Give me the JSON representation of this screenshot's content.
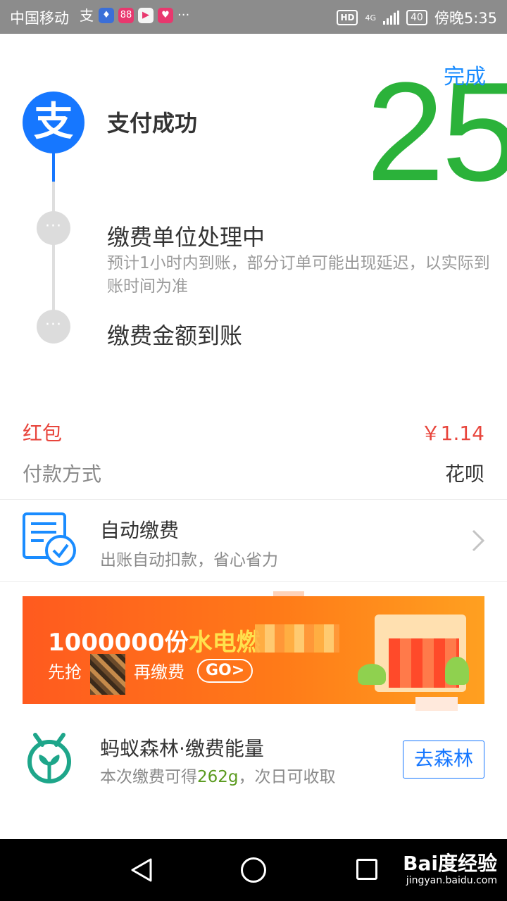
{
  "status_bar": {
    "carrier": "中国移动",
    "notif_1": "支",
    "notif_2": "♦",
    "notif_3": "88",
    "notif_4": "▶",
    "notif_5": "♥",
    "more": "···",
    "hd": "HD",
    "network": "4G",
    "battery": "40",
    "time": "傍晚5:35"
  },
  "header": {
    "done_label": "完成",
    "overlay_number": "25"
  },
  "timeline": {
    "logo_glyph": "支",
    "step1_title": "支付成功",
    "step2_title": "缴费单位处理中",
    "step2_desc": "预计1小时内到账，部分订单可能出现延迟，以实际到账时间为准",
    "step3_title": "缴费金额到账",
    "dot_glyph": "···"
  },
  "details": {
    "redpacket_label": "红包",
    "redpacket_value": "￥1.14",
    "pay_method_label": "付款方式",
    "pay_method_value": "花呗"
  },
  "auto_pay": {
    "title": "自动缴费",
    "subtitle": "出账自动扣款，省心省力"
  },
  "banner": {
    "line1_prefix": "1000000份",
    "line1_highlight": "水电燃",
    "line2_prefix": "先抢",
    "line2_suffix": "再缴费",
    "go_label": "GO>"
  },
  "forest": {
    "title": "蚂蚁森林·缴费能量",
    "sub_prefix": "本次缴费可得",
    "energy": "262g",
    "sub_suffix": "，次日可收取",
    "button_label": "去森林"
  },
  "nav_bar": {
    "watermark_main": "Bai度经验",
    "watermark_url": "jingyan.baidu.com"
  },
  "colors": {
    "accent_blue": "#1677ff",
    "success_green": "#2bb23a",
    "red": "#e8453c",
    "banner_orange": "#ff6a1a"
  },
  "icons": [
    "alipay-logo-icon",
    "more-dots-icon",
    "auto-pay-check-icon",
    "chevron-right-icon",
    "forest-sprout-icon",
    "back-icon",
    "home-icon",
    "recent-apps-icon"
  ]
}
